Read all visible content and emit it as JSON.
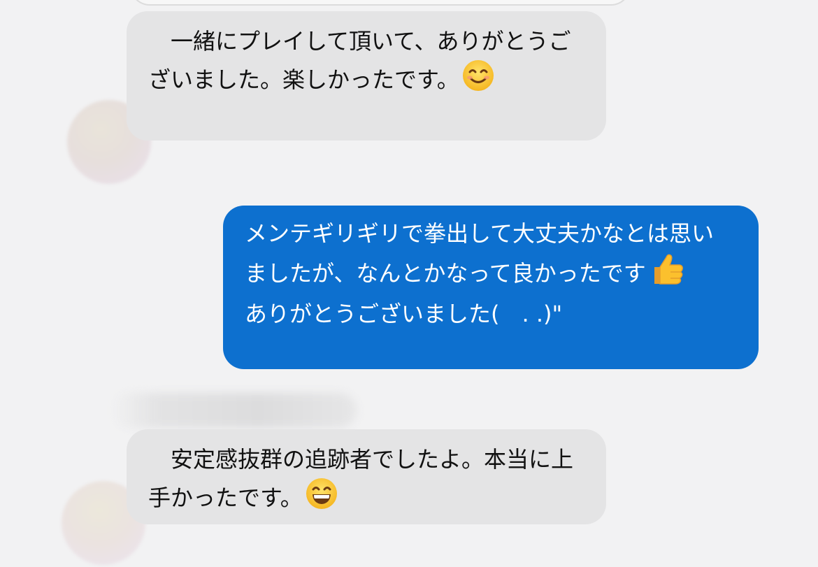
{
  "messages": [
    {
      "direction": "incoming",
      "text": "　一緒にプレイして頂いて、ありがとうございました。楽しかったです。",
      "emoji": "smiling-face-with-smiling-eyes"
    },
    {
      "direction": "outgoing",
      "text": "メンテギリギリで拳出して大丈夫かなとは思いましたが、なんとかなって良かったです",
      "emoji": "thumbs-up",
      "text2": "ありがとうございました(　. .)\""
    },
    {
      "direction": "incoming",
      "text": "　安定感抜群の追跡者でしたよ。本当に上手かったです。",
      "emoji": "grinning-face-with-smiling-eyes"
    }
  ],
  "colors": {
    "background": "#f2f2f3",
    "incoming_bubble": "#e4e4e5",
    "outgoing_bubble": "#0d70cf",
    "outgoing_text": "#ffffff"
  }
}
